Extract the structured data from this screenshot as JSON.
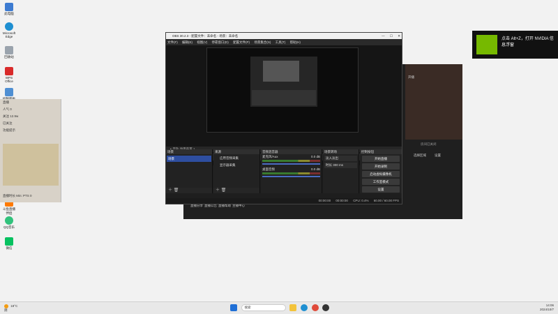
{
  "desktop": {
    "icons": [
      {
        "label": "此电脑",
        "icon": "computer-icon",
        "color": "#3d7bd1"
      },
      {
        "label": "Microsoft Edge",
        "icon": "edge-icon",
        "color": "#1f8fd1"
      },
      {
        "label": "回收站",
        "icon": "recycle-bin-icon",
        "color": "#9aa3ad"
      },
      {
        "label": "WPS Office",
        "icon": "wps-icon",
        "color": "#d92b2b"
      },
      {
        "label": "控制面板",
        "icon": "control-panel-icon",
        "color": "#4f8fd3"
      },
      {
        "label": "斗鱼直播伴侣",
        "icon": "douyu-icon",
        "color": "#ff7a00"
      },
      {
        "label": "QQ音乐",
        "icon": "qq-music-icon",
        "color": "#31c27c"
      },
      {
        "label": "微信",
        "icon": "wechat-icon",
        "color": "#07c160"
      }
    ]
  },
  "bg_left": {
    "rows": [
      "直播",
      "人气 0",
      "关注 12.9w",
      "已关注",
      "功能提示"
    ],
    "footer": "直播时长 Min: PTS 0"
  },
  "bg_right": {
    "tab": "开播",
    "status": "房间已关闭",
    "btn_a": "选择区域",
    "btn_b": "设置",
    "bottom_links": [
      "直播分享",
      "直播公告",
      "直播帮助",
      "主播中心"
    ]
  },
  "toast": {
    "text": "点击 Alt+Z，打开 NVIDIA 信息浮窗"
  },
  "obs": {
    "title": "OBS 30.2.3 - 配置文件：未命名 - 场景：未命名",
    "window_controls": [
      "—",
      "☐",
      "✕"
    ],
    "menu": [
      "文件(F)",
      "编辑(E)",
      "视图(V)",
      "停靠窗口(D)",
      "配置文件(P)",
      "场景集合(S)",
      "工具(T)",
      "帮助(H)"
    ],
    "preview_bar": "▸ 音轨   场景布置 1",
    "scene_bar": {
      "label": "未选择源",
      "props": "⚙ 属性",
      "filters": "▢ 滤镜"
    },
    "docks": {
      "scenes": {
        "title": "场景",
        "item": "场景"
      },
      "sources": {
        "title": "来源",
        "items": [
          "应用音频采集",
          "显示器采集"
        ]
      },
      "mixer": {
        "title": "音频混音器",
        "channels": [
          {
            "name": "麦克风/Aux",
            "level": "0.0 dB"
          },
          {
            "name": "桌面音频",
            "level": "0.0 dB"
          }
        ]
      },
      "transitions": {
        "title": "场景转场",
        "type": "淡入淡出",
        "duration_label": "时长",
        "duration": "300 ms"
      },
      "controls": {
        "title": "控制按钮",
        "buttons": [
          "开始直播",
          "开始录制",
          "启动虚拟摄像机",
          "工作室模式",
          "设置"
        ]
      }
    },
    "status": {
      "rec": "00:00:00",
      "stream": "00:00:00",
      "cpu": "CPU: 0.4%",
      "fps": "60.00 / 60.00 FPS"
    }
  },
  "taskbar": {
    "weather_temp": "18°C",
    "weather_desc": "阴",
    "search_placeholder": "搜索",
    "time": "14:06",
    "date": "2024/10/7",
    "apps": [
      {
        "icon": "start-icon",
        "color": "#1f6fd6"
      },
      {
        "icon": "file-explorer-icon",
        "color": "#f3c33b"
      },
      {
        "icon": "edge-taskbar-icon",
        "color": "#1f8fd1"
      },
      {
        "icon": "chrome-icon",
        "color": "#e04a3a"
      },
      {
        "icon": "obs-taskbar-icon",
        "color": "#333333"
      }
    ]
  },
  "colors": {
    "nvidia_green": "#76b900",
    "obs_selected": "#2e4ea0"
  }
}
